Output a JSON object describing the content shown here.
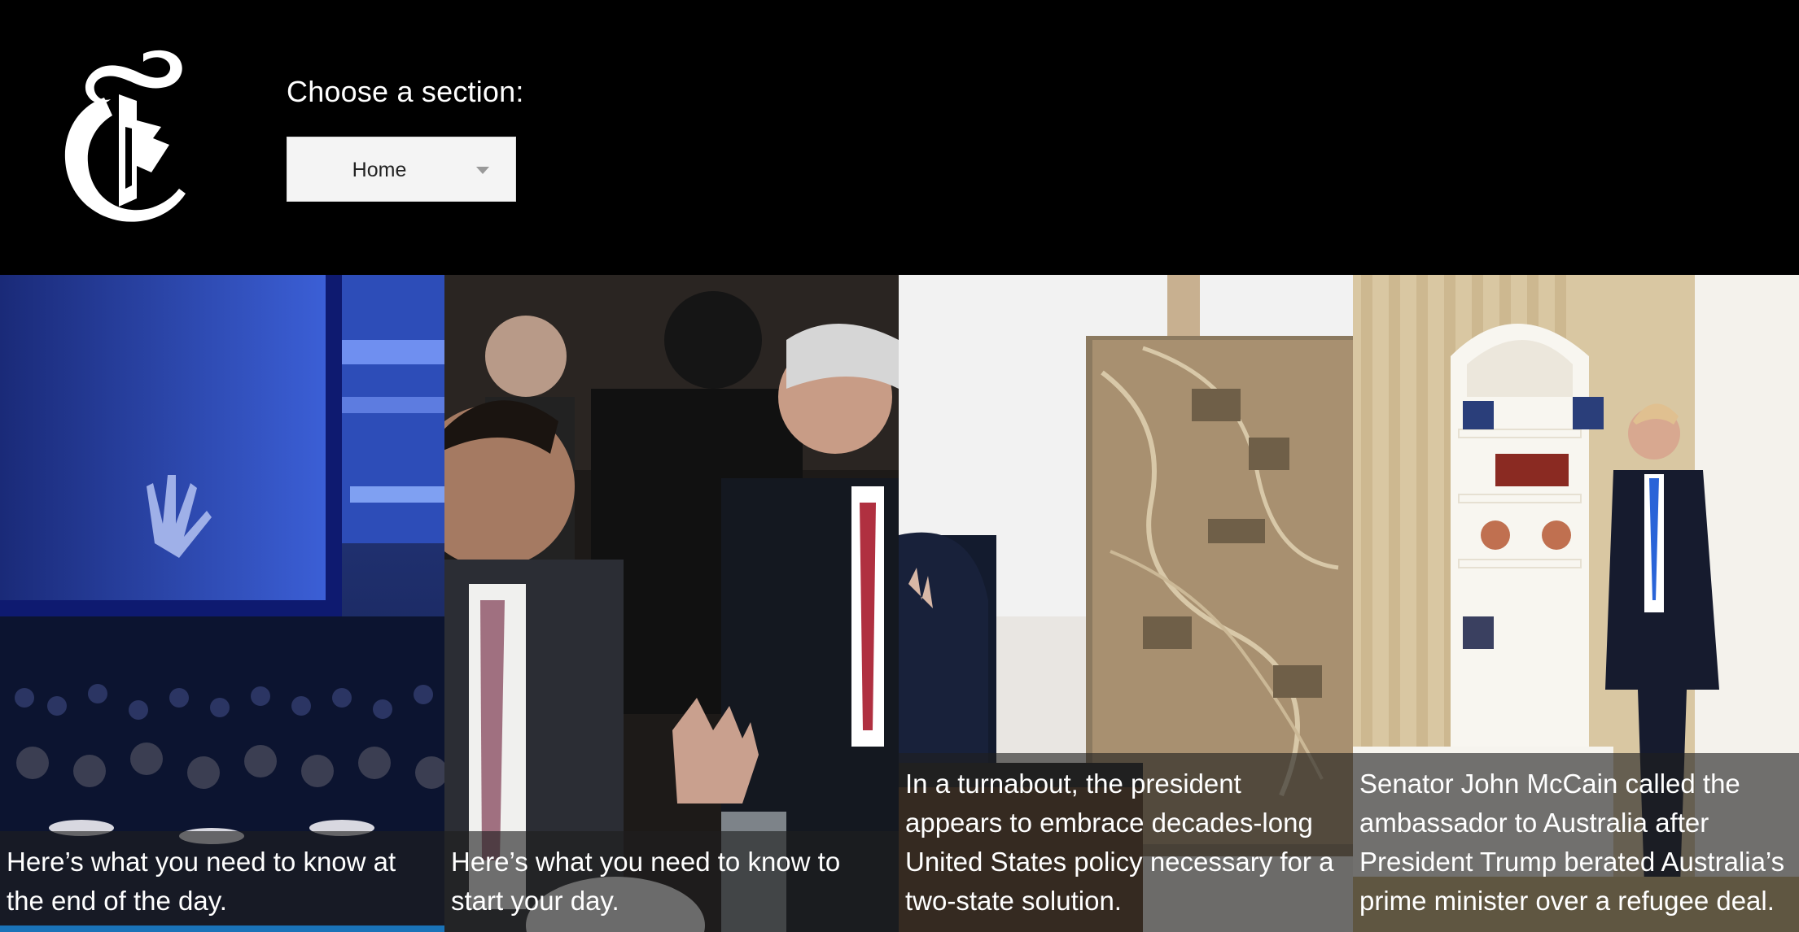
{
  "header": {
    "section_label": "Choose a section:",
    "section_select": {
      "selected": "Home"
    }
  },
  "tiles": [
    {
      "caption": "Here’s what you need to know at the end of the day.",
      "accent_color": "#1a73b8"
    },
    {
      "caption": "Here’s what you need to know to start your day.",
      "accent_color": "#000000"
    },
    {
      "caption": "In a turnabout, the president appears to embrace decades-long United States policy necessary for a two-state solution.",
      "accent_color": "#000000"
    },
    {
      "caption": "Senator John McCain called the ambassador to Australia after President Trump berated Australia’s prime minister over a refugee deal.",
      "accent_color": "#000000"
    }
  ],
  "icons": {
    "logo": "nyt-t-logo-icon",
    "caret": "chevron-down-icon"
  }
}
